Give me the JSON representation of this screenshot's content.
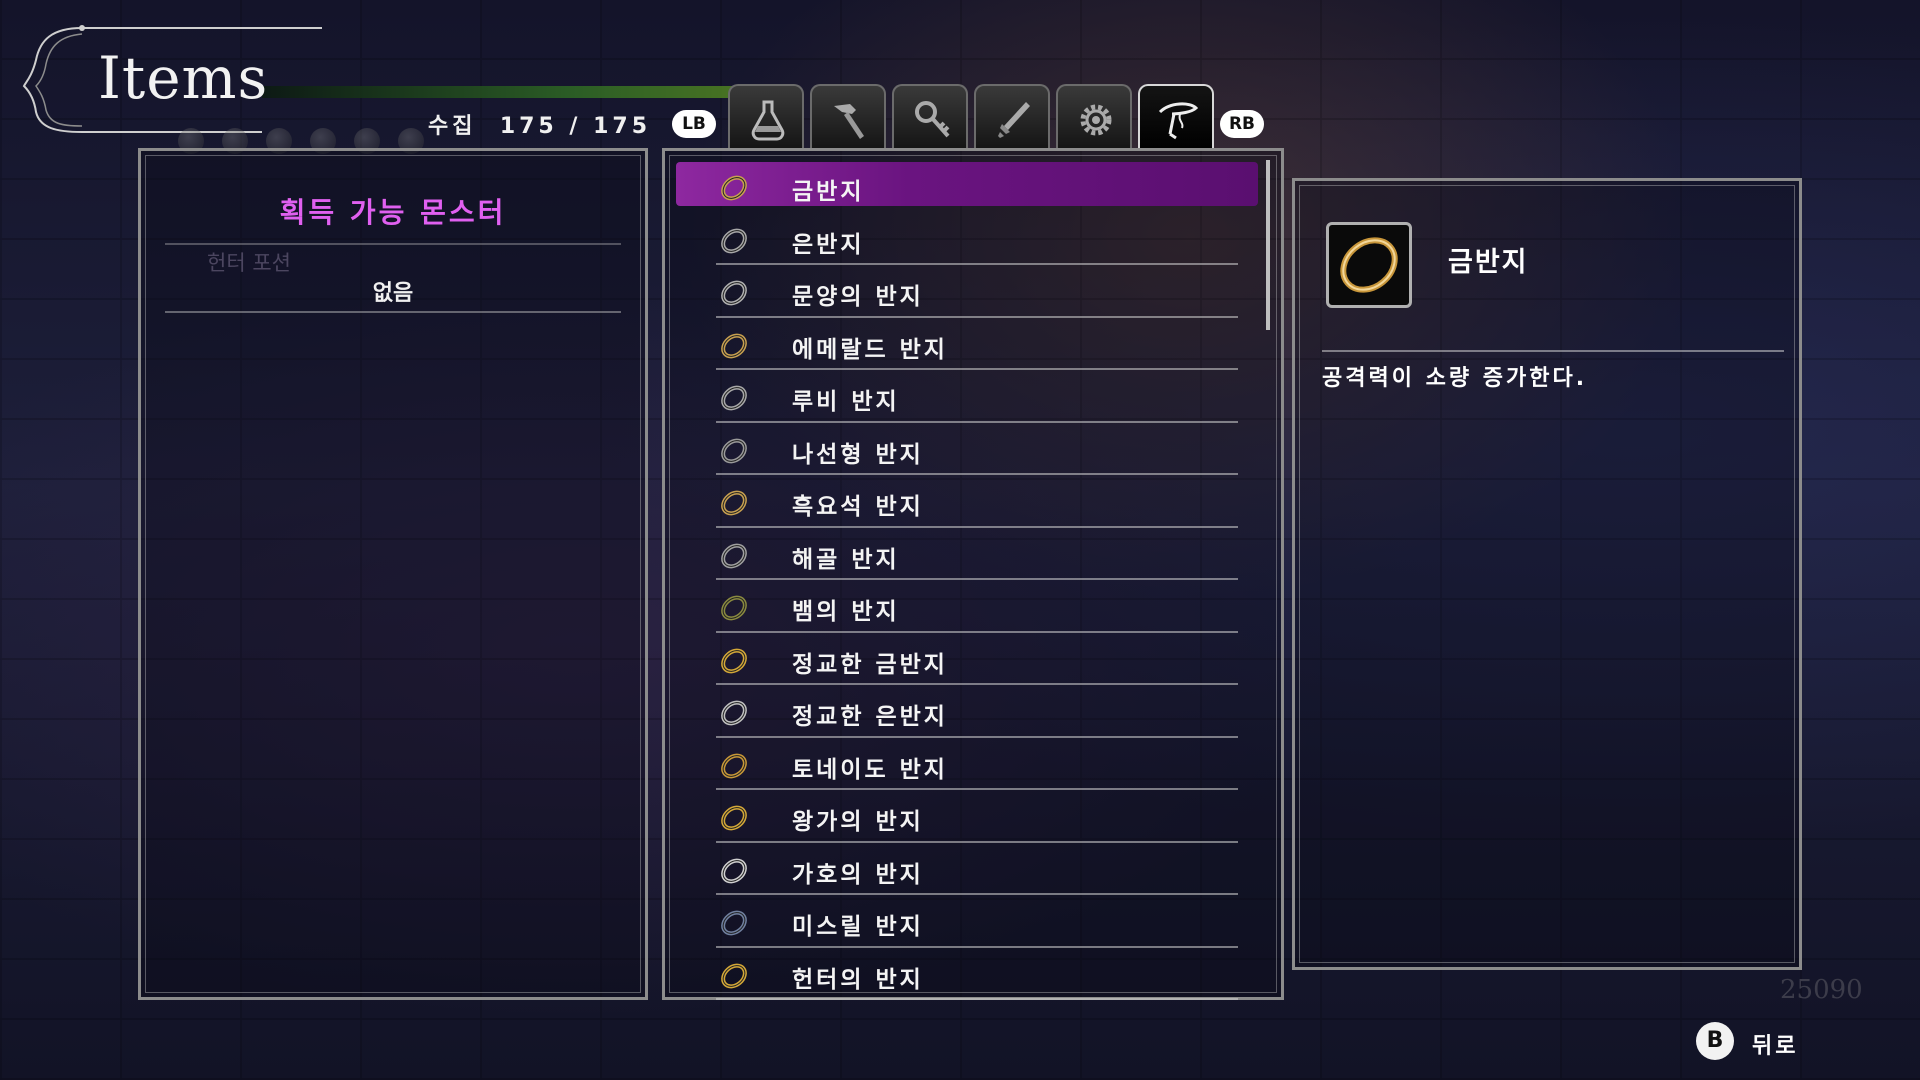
{
  "header": {
    "title": "Items",
    "collection_label": "수집",
    "collection_value": "175 / 175"
  },
  "tabs": {
    "lb_label": "LB",
    "rb_label": "RB",
    "items": [
      {
        "icon": "potion-icon",
        "active": false
      },
      {
        "icon": "hammer-icon",
        "active": false
      },
      {
        "icon": "key-icon",
        "active": false
      },
      {
        "icon": "sword-icon",
        "active": false
      },
      {
        "icon": "gear-icon",
        "active": false
      },
      {
        "icon": "ring-hook-icon",
        "active": true
      }
    ]
  },
  "left_panel": {
    "heading": "획득 가능 몬스터",
    "background_text": "헌터 포션",
    "none_label": "없음"
  },
  "item_list": {
    "selected_index": 0,
    "items": [
      {
        "label": "금반지",
        "icon": "gold-ring-icon",
        "color": "#c8a050"
      },
      {
        "label": "은반지",
        "icon": "silver-ring-icon",
        "color": "#a8a8a8"
      },
      {
        "label": "문양의 반지",
        "icon": "patterned-ring-icon",
        "color": "#b0b0b0"
      },
      {
        "label": "에메랄드 반지",
        "icon": "emerald-ring-icon",
        "color": "#c8a050"
      },
      {
        "label": "루비 반지",
        "icon": "ruby-ring-icon",
        "color": "#a8a8a8"
      },
      {
        "label": "나선형 반지",
        "icon": "spiral-ring-icon",
        "color": "#9a9a9a"
      },
      {
        "label": "흑요석 반지",
        "icon": "obsidian-ring-icon",
        "color": "#c8a050"
      },
      {
        "label": "해골 반지",
        "icon": "skull-ring-icon",
        "color": "#a0a0a0"
      },
      {
        "label": "뱀의 반지",
        "icon": "snake-ring-icon",
        "color": "#8a8a40"
      },
      {
        "label": "정교한 금반지",
        "icon": "fine-gold-ring-icon",
        "color": "#d4a838"
      },
      {
        "label": "정교한 은반지",
        "icon": "fine-silver-ring-icon",
        "color": "#c0c0c0"
      },
      {
        "label": "토네이도 반지",
        "icon": "tornado-ring-icon",
        "color": "#c89838"
      },
      {
        "label": "왕가의 반지",
        "icon": "royal-ring-icon",
        "color": "#d4a838"
      },
      {
        "label": "가호의 반지",
        "icon": "blessing-ring-icon",
        "color": "#d0d0d0"
      },
      {
        "label": "미스릴 반지",
        "icon": "mithril-ring-icon",
        "color": "#7080a0"
      },
      {
        "label": "헌터의 반지",
        "icon": "hunter-ring-icon",
        "color": "#d4a838"
      }
    ]
  },
  "detail": {
    "name": "금반지",
    "icon": "gold-ring-icon",
    "description": "공격력이 소량 증가한다."
  },
  "footer": {
    "gold_amount": "25090",
    "back_button": "B",
    "back_label": "뒤로"
  },
  "colors": {
    "accent_purple": "#7a1c90",
    "heading_pink": "#e060f0"
  }
}
